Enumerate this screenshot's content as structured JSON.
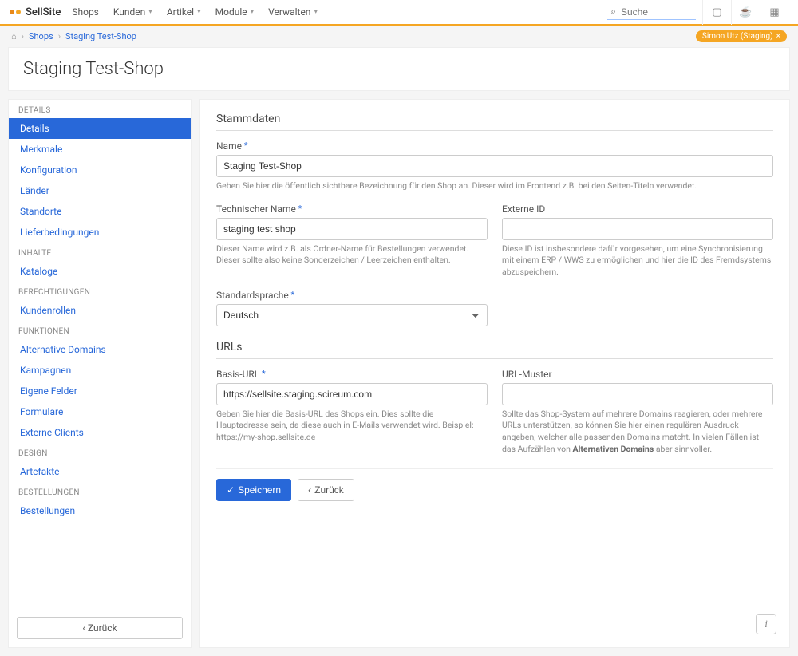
{
  "brand": "SellSite",
  "topnav": [
    "Shops",
    "Kunden",
    "Artikel",
    "Module",
    "Verwalten"
  ],
  "search": {
    "placeholder": "Suche"
  },
  "breadcrumb": {
    "home": "⌂",
    "items": [
      "Shops",
      "Staging Test-Shop"
    ]
  },
  "user_badge": {
    "label": "Simon Utz (Staging)",
    "close": "×"
  },
  "page_title": "Staging Test-Shop",
  "sidebar": {
    "sections": [
      {
        "title": "DETAILS",
        "items": [
          "Details",
          "Merkmale",
          "Konfiguration",
          "Länder",
          "Standorte",
          "Lieferbedingungen"
        ]
      },
      {
        "title": "INHALTE",
        "items": [
          "Kataloge"
        ]
      },
      {
        "title": "BERECHTIGUNGEN",
        "items": [
          "Kundenrollen"
        ]
      },
      {
        "title": "FUNKTIONEN",
        "items": [
          "Alternative Domains",
          "Kampagnen",
          "Eigene Felder",
          "Formulare",
          "Externe Clients"
        ]
      },
      {
        "title": "DESIGN",
        "items": [
          "Artefakte"
        ]
      },
      {
        "title": "BESTELLUNGEN",
        "items": [
          "Bestellungen"
        ]
      }
    ],
    "back_label": "Zurück"
  },
  "form": {
    "section1_title": "Stammdaten",
    "name": {
      "label": "Name",
      "value": "Staging Test-Shop",
      "help": "Geben Sie hier die öffentlich sichtbare Bezeichnung für den Shop an. Dieser wird im Frontend z.B. bei den Seiten-Titeln verwendet."
    },
    "techname": {
      "label": "Technischer Name",
      "value": "staging test shop",
      "help": "Dieser Name wird z.B. als Ordner-Name für Bestellungen verwendet. Dieser sollte also keine Sonderzeichen / Leerzeichen enthalten."
    },
    "extid": {
      "label": "Externe ID",
      "value": "",
      "help": "Diese ID ist insbesondere dafür vorgesehen, um eine Synchronisierung mit einem ERP / WWS zu ermöglichen und hier die ID des Fremdsystems abzuspeichern."
    },
    "lang": {
      "label": "Standardsprache",
      "value": "Deutsch"
    },
    "section2_title": "URLs",
    "baseurl": {
      "label": "Basis-URL",
      "value": "https://sellsite.staging.scireum.com",
      "help": "Geben Sie hier die Basis-URL des Shops ein. Dies sollte die Hauptadresse sein, da diese auch in E-Mails verwendet wird. Beispiel: https://my-shop.sellsite.de"
    },
    "urlpattern": {
      "label": "URL-Muster",
      "value": "",
      "help_pre": "Sollte das Shop-System auf mehrere Domains reagieren, oder mehrere URLs unterstützen, so können Sie hier einen regulären Ausdruck angeben, welcher alle passenden Domains matcht. In vielen Fällen ist das Aufzählen von ",
      "help_bold": "Alternativen Domains",
      "help_post": " aber sinnvoller."
    }
  },
  "actions": {
    "save": "Speichern",
    "back": "Zurück"
  }
}
